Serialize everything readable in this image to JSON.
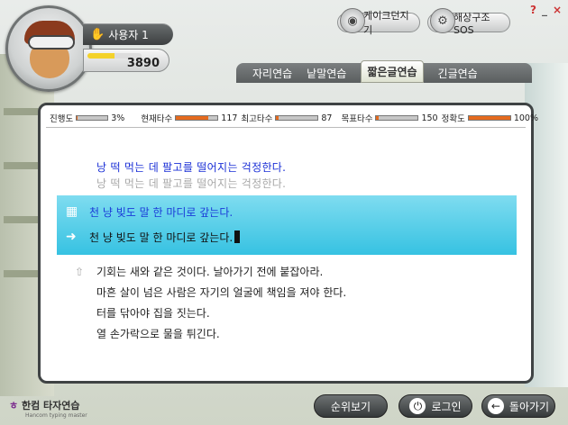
{
  "user": {
    "name": "사용자 1",
    "score": "3890",
    "score_progress": 0.5
  },
  "top_buttons": {
    "cake_game": "케이크던지기",
    "sea_rescue": "해상구조SOS"
  },
  "window_controls": {
    "help": "?",
    "minimize": "_",
    "close": "×"
  },
  "tabs": [
    {
      "label": "자리연습",
      "active": false
    },
    {
      "label": "낱말연습",
      "active": false
    },
    {
      "label": "짧은글연습",
      "active": true
    },
    {
      "label": "긴글연습",
      "active": false
    }
  ],
  "stats": {
    "progress_label": "진행도",
    "progress_value": "3%",
    "progress_fill": 0.03,
    "current_speed_label": "현재타수",
    "current_speed_value": "117",
    "current_speed_fill": 0.78,
    "max_speed_label": "최고타수",
    "max_speed_value": "87",
    "max_speed_fill": 0.06,
    "target_label": "목표타수",
    "target_value": "150",
    "target_fill": 0.06,
    "accuracy_label": "정확도",
    "accuracy_value": "100%",
    "accuracy_fill": 1.0
  },
  "practice": {
    "prev_target": "낭 떡 먹는 데 팔고를 떨어지는 걱정한다.",
    "prev_typed": "낭 떡 먹는 데 팔고를 떨어지는 걱정한다.",
    "current_target": "천 냥 빚도 말 한 마디로 갚는다.",
    "current_typed": "천 냥 빚도 말 한 마디로 갚는다.",
    "next_lines": [
      "기회는 새와 같은 것이다. 날아가기 전에 붙잡아라.",
      "마흔 살이 넘은 사람은 자기의 얼굴에 책임을 져야 한다.",
      "터를 닦아야 집을 짓는다.",
      "열 손가락으로 물을 튀긴다."
    ]
  },
  "colors": {
    "accent": "#36c2e2",
    "prev_target_text": "#1a2fd6",
    "prev_typed_text": "#a8a8a8",
    "current_target_text": "#1a3ad8",
    "current_typed_text": "#111111"
  },
  "bottom": {
    "logo_text": "한컴 타자연습",
    "logo_sub": "Hancom typing master",
    "ranking_button": "순위보기",
    "login_button": "로그인",
    "back_button": "돌아가기"
  }
}
